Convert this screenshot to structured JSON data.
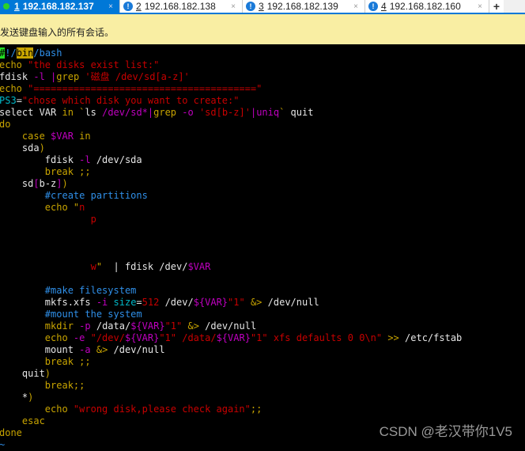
{
  "tabs": [
    {
      "num": "1",
      "label": "192.168.182.137",
      "active": true,
      "icon": "connected-dot-icon"
    },
    {
      "num": "2",
      "label": "192.168.182.138",
      "active": false,
      "icon": "warning-icon"
    },
    {
      "num": "3",
      "label": "192.168.182.139",
      "active": false,
      "icon": "warning-icon"
    },
    {
      "num": "4",
      "label": "192.168.182.160",
      "active": false,
      "icon": "warning-icon"
    }
  ],
  "tab_close": "×",
  "new_tab": "+",
  "notice": "发送键盘输入的所有会话。",
  "watermark": "CSDN @老汉带你1V5",
  "colors": {
    "accent": "#0078d7",
    "notice_bg": "#f9eea3",
    "terminal_bg": "#000000"
  },
  "lines": [
    [
      [
        "#",
        "hg"
      ],
      [
        "!/",
        "b"
      ],
      [
        "bin",
        "hy"
      ],
      [
        "/bash",
        "b"
      ]
    ],
    [
      [
        "echo ",
        "y"
      ],
      [
        "\"the disks exist list:\"",
        "r"
      ]
    ],
    [
      [
        "fdisk ",
        "w"
      ],
      [
        "-l ",
        "m"
      ],
      [
        "|",
        "m"
      ],
      [
        "grep ",
        "y"
      ],
      [
        "'磁盘 /dev/sd[a-z]'",
        "r"
      ]
    ],
    [
      [
        "echo ",
        "y"
      ],
      [
        "\"=======================================\"",
        "r"
      ]
    ],
    [
      [
        "PS3",
        "c"
      ],
      [
        "=",
        "w"
      ],
      [
        "\"chose which disk you want to create:\"",
        "r"
      ]
    ],
    [
      [
        "select VAR ",
        "w"
      ],
      [
        "in ",
        "y"
      ],
      [
        "`",
        "y"
      ],
      [
        "ls ",
        "w"
      ],
      [
        "/dev/sd*",
        "m"
      ],
      [
        "|",
        "m"
      ],
      [
        "grep ",
        "y"
      ],
      [
        "-o ",
        "m"
      ],
      [
        "'sd[b-z]'",
        "r"
      ],
      [
        "|uniq",
        "m"
      ],
      [
        "` ",
        "y"
      ],
      [
        "quit",
        "w"
      ]
    ],
    [
      [
        "do",
        "y"
      ]
    ],
    [
      [
        "    case ",
        "y"
      ],
      [
        "$VAR",
        "m"
      ],
      [
        " in",
        "y"
      ]
    ],
    [
      [
        "    sda",
        "w"
      ],
      [
        ")",
        "y"
      ]
    ],
    [
      [
        "        fdisk ",
        "w"
      ],
      [
        "-l",
        "m"
      ],
      [
        " /dev/sda",
        "w"
      ]
    ],
    [
      [
        "        break ;;",
        "y"
      ]
    ],
    [
      [
        "    sd",
        "w"
      ],
      [
        "[",
        "m"
      ],
      [
        "b-z",
        "w"
      ],
      [
        "]",
        "m"
      ],
      [
        ")",
        "y"
      ]
    ],
    [
      [
        "        #create partitions",
        "b"
      ]
    ],
    [
      [
        "        echo ",
        "y"
      ],
      [
        "\"",
        "y"
      ],
      [
        "n",
        "r"
      ]
    ],
    [
      [
        "                p",
        "r"
      ]
    ],
    [],
    [],
    [],
    [
      [
        "                w",
        "r"
      ],
      [
        "\"",
        "y"
      ],
      [
        "  | fdisk /dev/",
        "w"
      ],
      [
        "$VAR",
        "m"
      ]
    ],
    [],
    [
      [
        "        #make filesystem",
        "b"
      ]
    ],
    [
      [
        "        mkfs.xfs ",
        "w"
      ],
      [
        "-i ",
        "m"
      ],
      [
        "size",
        "c"
      ],
      [
        "=",
        "w"
      ],
      [
        "512 ",
        "r"
      ],
      [
        "/dev/",
        "w"
      ],
      [
        "${VAR}",
        "m"
      ],
      [
        "\"1\"",
        "r"
      ],
      [
        " &> ",
        "y"
      ],
      [
        "/dev/null",
        "w"
      ]
    ],
    [
      [
        "        #mount the system",
        "b"
      ]
    ],
    [
      [
        "        mkdir ",
        "y"
      ],
      [
        "-p ",
        "m"
      ],
      [
        "/data/",
        "w"
      ],
      [
        "${VAR}",
        "m"
      ],
      [
        "\"1\"",
        "r"
      ],
      [
        " &> ",
        "y"
      ],
      [
        "/dev/null",
        "w"
      ]
    ],
    [
      [
        "        echo ",
        "y"
      ],
      [
        "-e ",
        "m"
      ],
      [
        "\"/dev/",
        "r"
      ],
      [
        "${VAR}",
        "m"
      ],
      [
        "\"1\" /data/",
        "r"
      ],
      [
        "${VAR}",
        "m"
      ],
      [
        "\"1\" xfs defaults 0 0\\n\"",
        "r"
      ],
      [
        " >> ",
        "y"
      ],
      [
        "/etc/fstab",
        "w"
      ]
    ],
    [
      [
        "        mount ",
        "w"
      ],
      [
        "-a ",
        "m"
      ],
      [
        "&> ",
        "y"
      ],
      [
        "/dev/null",
        "w"
      ]
    ],
    [
      [
        "        break ;;",
        "y"
      ]
    ],
    [
      [
        "    quit",
        "w"
      ],
      [
        ")",
        "y"
      ]
    ],
    [
      [
        "        break;;",
        "y"
      ]
    ],
    [
      [
        "    *",
        "w"
      ],
      [
        ")",
        "y"
      ]
    ],
    [
      [
        "        echo ",
        "y"
      ],
      [
        "\"wrong disk,please check again\"",
        "r"
      ],
      [
        ";;",
        "y"
      ]
    ],
    [
      [
        "    esac",
        "y"
      ]
    ],
    [
      [
        "done",
        "y"
      ]
    ],
    [
      [
        "~",
        "b"
      ]
    ]
  ]
}
